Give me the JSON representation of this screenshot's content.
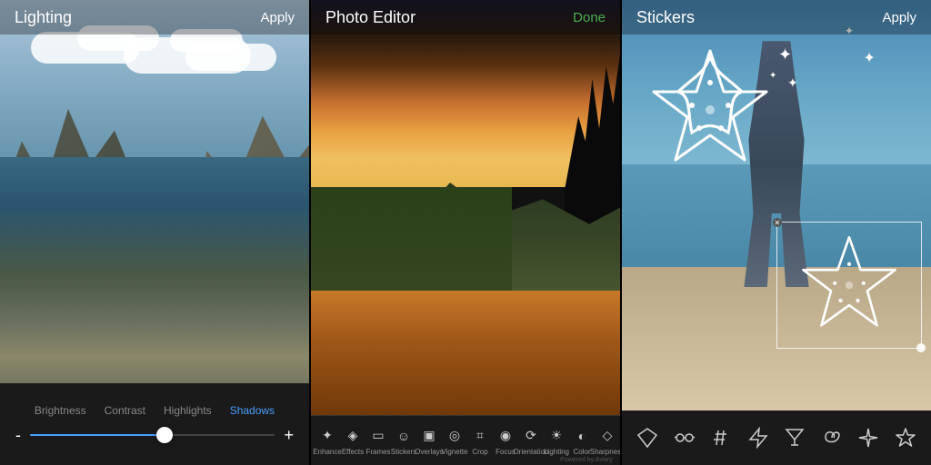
{
  "panel1": {
    "title": "Lighting",
    "action": "Apply",
    "tabs": [
      {
        "label": "Brightness",
        "active": false
      },
      {
        "label": "Contrast",
        "active": false
      },
      {
        "label": "Highlights",
        "active": false
      },
      {
        "label": "Shadows",
        "active": true
      }
    ],
    "slider": {
      "minus": "-",
      "plus": "+",
      "value": 55
    }
  },
  "panel2": {
    "title": "Photo Editor",
    "action": "Done",
    "tools": [
      {
        "label": "Enhance",
        "icon": "✦"
      },
      {
        "label": "Effects",
        "icon": "◈"
      },
      {
        "label": "Frames",
        "icon": "▭"
      },
      {
        "label": "Stickers",
        "icon": "☺"
      },
      {
        "label": "Overlays",
        "icon": "▣"
      },
      {
        "label": "Vignette",
        "icon": "◎"
      },
      {
        "label": "Crop",
        "icon": "⌗"
      },
      {
        "label": "Focus",
        "icon": "◉"
      },
      {
        "label": "Orientation",
        "icon": "⟳"
      },
      {
        "label": "Lighting",
        "icon": "☀"
      },
      {
        "label": "Color",
        "icon": "◐"
      },
      {
        "label": "Sharpness",
        "icon": "◇"
      }
    ],
    "watermark": "Powered by Aviary"
  },
  "panel3": {
    "title": "Stickers",
    "action": "Apply",
    "sticker_tools": [
      {
        "label": "diamond",
        "icon": "♦"
      },
      {
        "label": "glasses",
        "icon": "👓"
      },
      {
        "label": "hashtag",
        "icon": "#"
      },
      {
        "label": "lightning",
        "icon": "⚡"
      },
      {
        "label": "cocktail",
        "icon": "🍸"
      },
      {
        "label": "fish",
        "icon": "𝄆"
      },
      {
        "label": "sparkle",
        "icon": "✳"
      },
      {
        "label": "starfish",
        "icon": "✦"
      }
    ]
  }
}
